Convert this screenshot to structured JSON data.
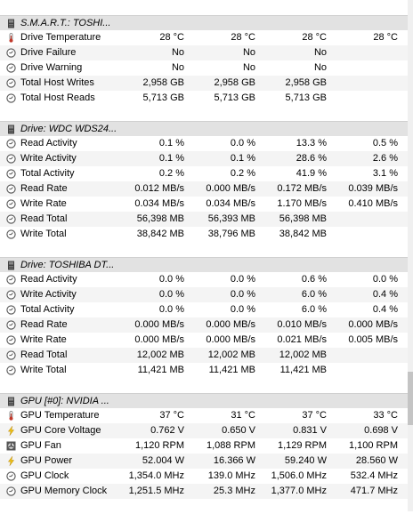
{
  "sections": [
    {
      "title": "S.M.A.R.T.: TOSHI...",
      "icon": "drive-icon",
      "rows": [
        {
          "icon": "thermometer-icon",
          "label": "Drive Temperature",
          "values": [
            "28 °C",
            "28 °C",
            "28 °C",
            "28 °C"
          ]
        },
        {
          "icon": "clock-icon",
          "label": "Drive Failure",
          "values": [
            "No",
            "No",
            "No",
            ""
          ]
        },
        {
          "icon": "clock-icon",
          "label": "Drive Warning",
          "values": [
            "No",
            "No",
            "No",
            ""
          ]
        },
        {
          "icon": "clock-icon",
          "label": "Total Host Writes",
          "values": [
            "2,958 GB",
            "2,958 GB",
            "2,958 GB",
            ""
          ]
        },
        {
          "icon": "clock-icon",
          "label": "Total Host Reads",
          "values": [
            "5,713 GB",
            "5,713 GB",
            "5,713 GB",
            ""
          ]
        }
      ]
    },
    {
      "title": "Drive: WDC WDS24...",
      "icon": "drive-icon",
      "rows": [
        {
          "icon": "clock-icon",
          "label": "Read Activity",
          "values": [
            "0.1 %",
            "0.0 %",
            "13.3 %",
            "0.5 %"
          ]
        },
        {
          "icon": "clock-icon",
          "label": "Write Activity",
          "values": [
            "0.1 %",
            "0.1 %",
            "28.6 %",
            "2.6 %"
          ]
        },
        {
          "icon": "clock-icon",
          "label": "Total Activity",
          "values": [
            "0.2 %",
            "0.2 %",
            "41.9 %",
            "3.1 %"
          ]
        },
        {
          "icon": "clock-icon",
          "label": "Read Rate",
          "values": [
            "0.012 MB/s",
            "0.000 MB/s",
            "0.172 MB/s",
            "0.039 MB/s"
          ]
        },
        {
          "icon": "clock-icon",
          "label": "Write Rate",
          "values": [
            "0.034 MB/s",
            "0.034 MB/s",
            "1.170 MB/s",
            "0.410 MB/s"
          ]
        },
        {
          "icon": "clock-icon",
          "label": "Read Total",
          "values": [
            "56,398 MB",
            "56,393 MB",
            "56,398 MB",
            ""
          ]
        },
        {
          "icon": "clock-icon",
          "label": "Write Total",
          "values": [
            "38,842 MB",
            "38,796 MB",
            "38,842 MB",
            ""
          ]
        }
      ]
    },
    {
      "title": "Drive: TOSHIBA DT...",
      "icon": "drive-icon",
      "rows": [
        {
          "icon": "clock-icon",
          "label": "Read Activity",
          "values": [
            "0.0 %",
            "0.0 %",
            "0.6 %",
            "0.0 %"
          ]
        },
        {
          "icon": "clock-icon",
          "label": "Write Activity",
          "values": [
            "0.0 %",
            "0.0 %",
            "6.0 %",
            "0.4 %"
          ]
        },
        {
          "icon": "clock-icon",
          "label": "Total Activity",
          "values": [
            "0.0 %",
            "0.0 %",
            "6.0 %",
            "0.4 %"
          ]
        },
        {
          "icon": "clock-icon",
          "label": "Read Rate",
          "values": [
            "0.000 MB/s",
            "0.000 MB/s",
            "0.010 MB/s",
            "0.000 MB/s"
          ]
        },
        {
          "icon": "clock-icon",
          "label": "Write Rate",
          "values": [
            "0.000 MB/s",
            "0.000 MB/s",
            "0.021 MB/s",
            "0.005 MB/s"
          ]
        },
        {
          "icon": "clock-icon",
          "label": "Read Total",
          "values": [
            "12,002 MB",
            "12,002 MB",
            "12,002 MB",
            ""
          ]
        },
        {
          "icon": "clock-icon",
          "label": "Write Total",
          "values": [
            "11,421 MB",
            "11,421 MB",
            "11,421 MB",
            ""
          ]
        }
      ]
    },
    {
      "title": "GPU [#0]: NVIDIA ...",
      "icon": "gpu-icon",
      "rows": [
        {
          "icon": "thermometer-icon",
          "label": "GPU Temperature",
          "values": [
            "37 °C",
            "31 °C",
            "37 °C",
            "33 °C"
          ]
        },
        {
          "icon": "lightning-icon",
          "label": "GPU Core Voltage",
          "values": [
            "0.762 V",
            "0.650 V",
            "0.831 V",
            "0.698 V"
          ]
        },
        {
          "icon": "fan-icon",
          "label": "GPU Fan",
          "values": [
            "1,120 RPM",
            "1,088 RPM",
            "1,129 RPM",
            "1,100 RPM"
          ]
        },
        {
          "icon": "lightning-icon",
          "label": "GPU Power",
          "values": [
            "52.004 W",
            "16.366 W",
            "59.240 W",
            "28.560 W"
          ]
        },
        {
          "icon": "clock-icon",
          "label": "GPU Clock",
          "values": [
            "1,354.0 MHz",
            "139.0 MHz",
            "1,506.0 MHz",
            "532.4 MHz"
          ]
        },
        {
          "icon": "clock-icon",
          "label": "GPU Memory Clock",
          "values": [
            "1,251.5 MHz",
            "25.3 MHz",
            "1,377.0 MHz",
            "471.7 MHz"
          ]
        }
      ]
    }
  ],
  "colors": {
    "header_bg": "#e2e2e2",
    "alt_row_bg": "#f4f4f4",
    "thermometer": "#c0392b",
    "lightning": "#f1c40f",
    "clock": "#555555"
  }
}
